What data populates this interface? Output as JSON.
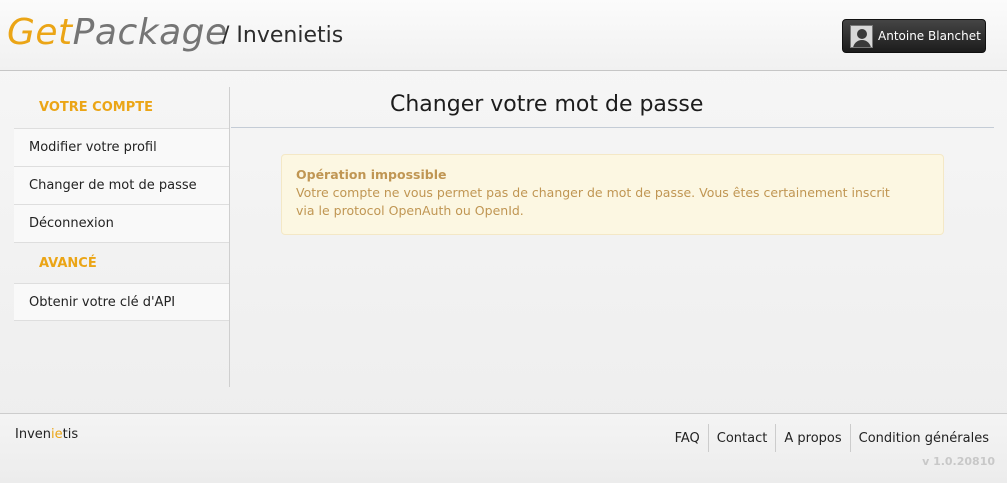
{
  "header": {
    "logo_get": "Get",
    "logo_package": "Package",
    "breadcrumb": "/ Invenietis",
    "user_name": "Antoine Blanchet"
  },
  "sidebar": {
    "section_account": "VOTRE COMPTE",
    "items": [
      {
        "label": "Modifier votre profil"
      },
      {
        "label": "Changer de mot de passe"
      },
      {
        "label": "Déconnexion"
      }
    ],
    "section_advanced": "AVANCÉ",
    "advanced_items": [
      {
        "label": "Obtenir votre clé d'API"
      }
    ]
  },
  "main": {
    "title": "Changer votre mot de passe",
    "alert_title": "Opération impossible",
    "alert_line1": "Votre compte ne vous permet pas de changer de mot de passe. Vous êtes certainement inscrit",
    "alert_line2": "via le protocol OpenAuth ou OpenId."
  },
  "footer": {
    "brand_pre": "Inven",
    "brand_mid": "ie",
    "brand_post": "tis",
    "links": [
      {
        "label": "FAQ"
      },
      {
        "label": "Contact"
      },
      {
        "label": "A propos"
      },
      {
        "label": "Condition générales"
      }
    ],
    "version": "v 1.0.20810"
  },
  "colors": {
    "accent": "#eba516",
    "alert_text": "#c09653",
    "alert_bg": "#fcf7e2"
  }
}
